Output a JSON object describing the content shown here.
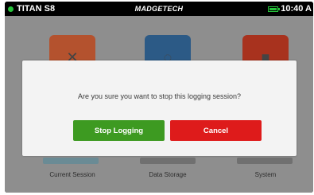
{
  "status_bar": {
    "device_name": "TITAN S8",
    "brand": "MADGETECH",
    "time": "10:40 A"
  },
  "tiles": [
    {
      "label": "Current Session",
      "icon": "tools-icon"
    },
    {
      "label": "Data Storage",
      "icon": "storage-icon"
    },
    {
      "label": "System",
      "icon": "system-icon"
    }
  ],
  "dialog": {
    "message": "Are you sure you want to stop this logging session?",
    "confirm_label": "Stop Logging",
    "cancel_label": "Cancel"
  },
  "colors": {
    "confirm": "#3d9a21",
    "cancel": "#de1b1b",
    "status_green": "#25c43a"
  }
}
